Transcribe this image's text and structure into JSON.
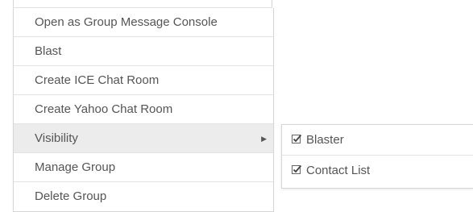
{
  "menu": {
    "items": [
      {
        "label": "Open as Group Message Console"
      },
      {
        "label": "Blast"
      },
      {
        "label": "Create ICE Chat Room"
      },
      {
        "label": "Create Yahoo Chat Room"
      },
      {
        "label": "Visibility",
        "has_submenu": true,
        "active": true
      },
      {
        "label": "Manage Group"
      },
      {
        "label": "Delete Group"
      }
    ],
    "arrow_icon": "caret-right-icon"
  },
  "submenu": {
    "items": [
      {
        "label": "Blaster",
        "checked": true,
        "icon": "checkbox-checked-icon"
      },
      {
        "label": "Contact List",
        "checked": true,
        "icon": "checkbox-checked-icon"
      }
    ]
  },
  "colors": {
    "text": "#555555",
    "hover": "#ececec",
    "border": "#d6d6d6"
  }
}
